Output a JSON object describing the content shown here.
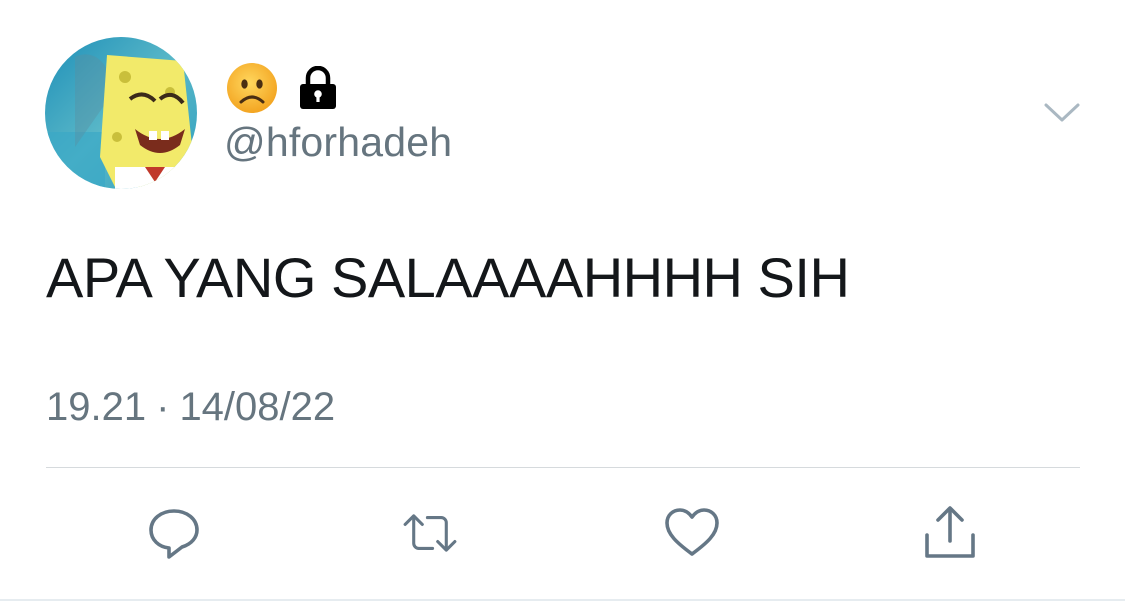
{
  "tweet": {
    "author": {
      "avatar_icon": "avatar-image",
      "name_emoji": "frowning-face-icon",
      "protected_icon": "lock-icon",
      "handle": "@hforhadeh"
    },
    "text": "APA YANG SALAAAAHHHH SIH",
    "time": "19.21",
    "separator": "·",
    "date": "14/08/22",
    "menu_icon": "chevron-down-icon"
  },
  "actions": [
    {
      "name": "reply",
      "icon": "comment-icon"
    },
    {
      "name": "retweet",
      "icon": "retweet-icon"
    },
    {
      "name": "like",
      "icon": "heart-icon"
    },
    {
      "name": "share",
      "icon": "share-icon"
    }
  ],
  "colors": {
    "text": "#14171a",
    "secondary": "#66757f",
    "divider": "#d6dadd",
    "icon": "#657786"
  }
}
